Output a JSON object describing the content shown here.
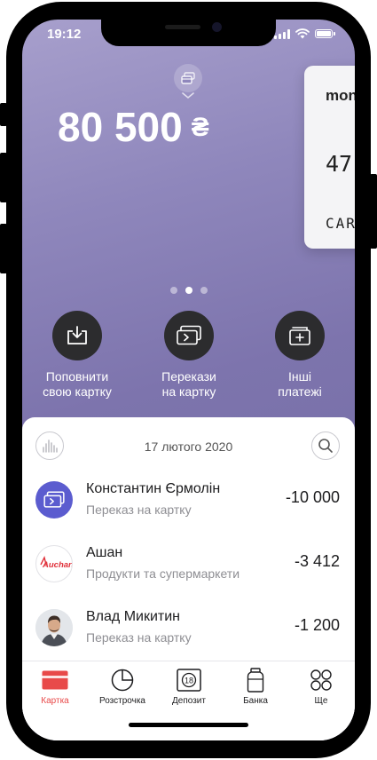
{
  "status_bar": {
    "time": "19:12"
  },
  "account": {
    "balance": "80 500",
    "currency": "₴"
  },
  "card": {
    "brand": "mon",
    "number": "47",
    "name": "CAR"
  },
  "carousel": {
    "count": 3,
    "active_index": 1
  },
  "actions": [
    {
      "label": "Поповнити\nсвою картку",
      "icon": "download-icon"
    },
    {
      "label": "Перекази\nна картку",
      "icon": "card-transfer-icon"
    },
    {
      "label": "Інші\nплатежі",
      "icon": "folder-plus-icon"
    }
  ],
  "feed": {
    "date": "17 лютого 2020",
    "transactions": [
      {
        "title": "Константин Єрмолін",
        "subtitle": "Переказ на картку",
        "amount": "-10 000",
        "avatar": "card-transfer-icon"
      },
      {
        "title": "Ашан",
        "subtitle": "Продукти та супермаркети",
        "amount": "-3 412",
        "avatar": "auchan-logo",
        "logo_text": "Auchan"
      },
      {
        "title": "Влад Микитин",
        "subtitle": "Переказ на картку",
        "amount": "-1 200",
        "avatar": "user-photo"
      }
    ]
  },
  "tabbar": {
    "items": [
      {
        "label": "Картка",
        "icon": "card-icon",
        "active": true
      },
      {
        "label": "Розстрочка",
        "icon": "pie-chart-icon",
        "active": false
      },
      {
        "label": "Депозит",
        "icon": "deposit-icon",
        "active": false,
        "badge": "18"
      },
      {
        "label": "Банка",
        "icon": "jar-icon",
        "active": false
      },
      {
        "label": "Ще",
        "icon": "more-grid-icon",
        "active": false
      }
    ]
  },
  "colors": {
    "accent": "#e84a4a",
    "action_button": "#2c2c2e",
    "gradient_start": "#a79fcc",
    "gradient_end": "#6f6aa0",
    "transfer_avatar": "#5b5ccf"
  }
}
